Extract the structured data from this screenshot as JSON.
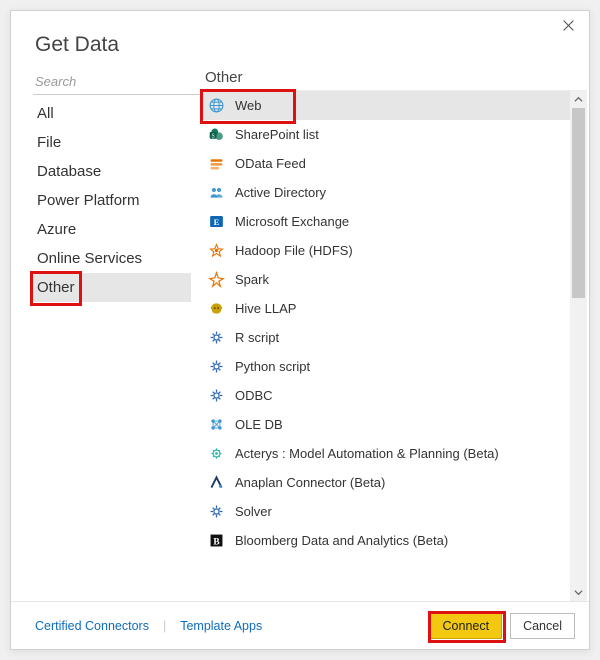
{
  "dialog": {
    "title": "Get Data",
    "close_tooltip": "Close"
  },
  "search": {
    "placeholder": "Search"
  },
  "categories": [
    {
      "label": "All"
    },
    {
      "label": "File"
    },
    {
      "label": "Database"
    },
    {
      "label": "Power Platform"
    },
    {
      "label": "Azure"
    },
    {
      "label": "Online Services"
    },
    {
      "label": "Other",
      "selected": true
    }
  ],
  "right": {
    "heading": "Other",
    "items": [
      {
        "label": "Web",
        "icon": "globe-icon",
        "color": "#3a96d0",
        "selected": true
      },
      {
        "label": "SharePoint list",
        "icon": "sharepoint-icon",
        "color": "#0f7a5e"
      },
      {
        "label": "OData Feed",
        "icon": "odata-icon",
        "color": "#e97300"
      },
      {
        "label": "Active Directory",
        "icon": "active-directory-icon",
        "color": "#3a96d0"
      },
      {
        "label": "Microsoft Exchange",
        "icon": "exchange-icon",
        "color": "#0d67b5"
      },
      {
        "label": "Hadoop File (HDFS)",
        "icon": "hadoop-icon",
        "color": "#e97300"
      },
      {
        "label": "Spark",
        "icon": "spark-icon",
        "color": "#e97300"
      },
      {
        "label": "Hive LLAP",
        "icon": "hive-icon",
        "color": "#c9a108"
      },
      {
        "label": "R script",
        "icon": "r-script-icon",
        "color": "#306ab5"
      },
      {
        "label": "Python script",
        "icon": "python-script-icon",
        "color": "#306ab5"
      },
      {
        "label": "ODBC",
        "icon": "odbc-icon",
        "color": "#306ab5"
      },
      {
        "label": "OLE DB",
        "icon": "oledb-icon",
        "color": "#3a96d0"
      },
      {
        "label": "Acterys : Model Automation & Planning (Beta)",
        "icon": "acterys-icon",
        "color": "#2cb8a8"
      },
      {
        "label": "Anaplan Connector (Beta)",
        "icon": "anaplan-icon",
        "color": "#1b3a66"
      },
      {
        "label": "Solver",
        "icon": "solver-icon",
        "color": "#306ab5"
      },
      {
        "label": "Bloomberg Data and Analytics (Beta)",
        "icon": "bloomberg-icon",
        "color": "#111"
      }
    ]
  },
  "footer": {
    "link_certified": "Certified Connectors",
    "link_templates": "Template Apps",
    "connect": "Connect",
    "cancel": "Cancel"
  }
}
